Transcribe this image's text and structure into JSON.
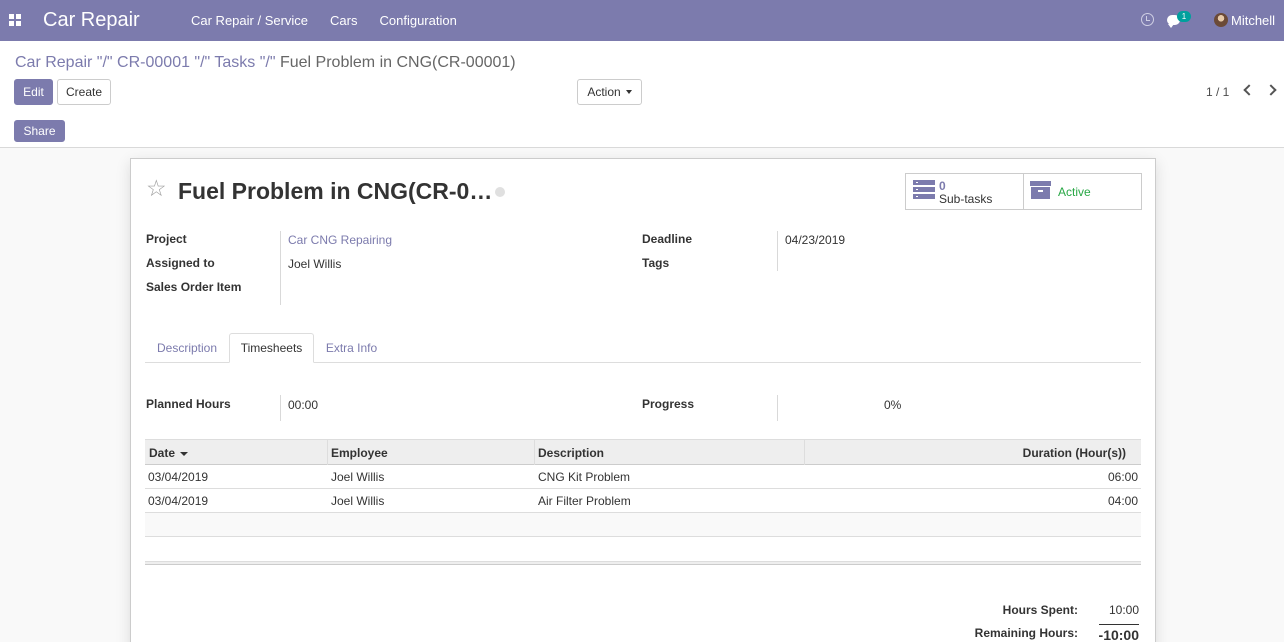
{
  "navbar": {
    "app_name": "Car Repair",
    "menu": [
      "Car Repair / Service",
      "Cars",
      "Configuration"
    ],
    "chat_badge": "1",
    "user_name": "Mitchell",
    "icons": [
      "apps-grid-icon",
      "clock-icon",
      "chat-icon"
    ]
  },
  "control_panel": {
    "breadcrumb": {
      "part1": "Car Repair \"/\" CR-00001 \"/\" Tasks \"/\" ",
      "current": "Fuel Problem in CNG(CR-00001)"
    },
    "edit_label": "Edit",
    "create_label": "Create",
    "action_label": "Action",
    "pager": "1 / 1",
    "share_label": "Share"
  },
  "form": {
    "title": "Fuel Problem in CNG(CR-0…",
    "subtasks_count": "0",
    "subtasks_label": "Sub-tasks",
    "active_label": "Active",
    "fields": {
      "project_label": "Project",
      "project_value": "Car CNG Repairing",
      "assigned_label": "Assigned to",
      "assigned_value": "Joel Willis",
      "sales_order_label": "Sales Order Item",
      "deadline_label": "Deadline",
      "deadline_value": "04/23/2019",
      "tags_label": "Tags"
    },
    "tabs": [
      "Description",
      "Timesheets",
      "Extra Info"
    ],
    "active_tab": "Timesheets",
    "planned_hours_label": "Planned Hours",
    "planned_hours_value": "00:00",
    "progress_label": "Progress",
    "progress_value": "0%",
    "timesheet": {
      "columns": [
        "Date",
        "Employee",
        "Description",
        "Duration (Hour(s))"
      ],
      "rows": [
        {
          "date": "03/04/2019",
          "employee": "Joel Willis",
          "description": "CNG Kit Problem",
          "duration": "06:00"
        },
        {
          "date": "03/04/2019",
          "employee": "Joel Willis",
          "description": "Air Filter Problem",
          "duration": "04:00"
        }
      ]
    },
    "hours_spent_label": "Hours Spent:",
    "hours_spent_value": "10:00",
    "remaining_hours_label": "Remaining Hours:",
    "remaining_hours_value": "-10:00"
  }
}
